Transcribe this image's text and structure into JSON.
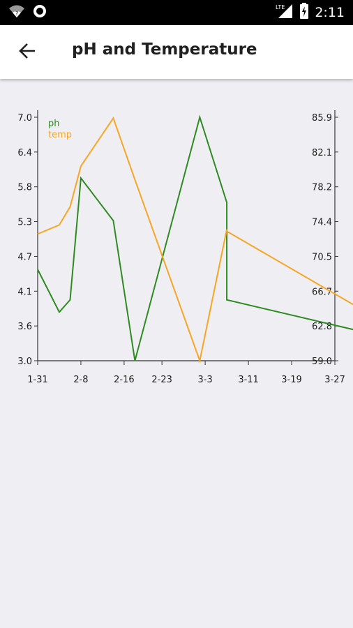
{
  "status_bar": {
    "time": "2:11",
    "network_label": "LTE",
    "icons": [
      "wifi-icon",
      "record-icon",
      "signal-icon",
      "battery-charging-icon"
    ]
  },
  "app_bar": {
    "title": "pH and Temperature",
    "back_icon": "arrow-back-icon"
  },
  "chart_data": {
    "type": "line",
    "x": [
      "1-31",
      "2-4",
      "2-6",
      "2-8",
      "2-14",
      "2-18",
      "3-2",
      "3-7",
      "3-7",
      "3-31"
    ],
    "series": [
      {
        "name": "ph",
        "axis": "left",
        "color": "#2e8b22",
        "values": [
          4.5,
          3.8,
          4.0,
          6.0,
          5.3,
          3.0,
          7.0,
          5.6,
          4.0,
          3.5
        ]
      },
      {
        "name": "temp",
        "axis": "right",
        "color": "#f5a623",
        "values": [
          73.0,
          74.0,
          76.0,
          80.5,
          85.8,
          79.0,
          59.0,
          73.5,
          73.3,
          65.0
        ]
      }
    ],
    "xlabel": "",
    "ylabel_left": "",
    "ylabel_right": "",
    "x_tick_labels": [
      "1-31",
      "2-8",
      "2-16",
      "2-23",
      "3-3",
      "3-11",
      "3-19",
      "3-27"
    ],
    "y_left": {
      "min": 3.0,
      "max": 7.0,
      "ticks": [
        "3.0",
        "3.6",
        "4.1",
        "4.7",
        "5.3",
        "5.8",
        "6.4",
        "7.0"
      ]
    },
    "y_right": {
      "min": 59.0,
      "max": 85.9,
      "ticks": [
        "59.0",
        "62.8",
        "66.7",
        "70.5",
        "74.4",
        "78.2",
        "82.1",
        "85.9"
      ]
    },
    "legend_position": "top-left",
    "grid": false
  }
}
